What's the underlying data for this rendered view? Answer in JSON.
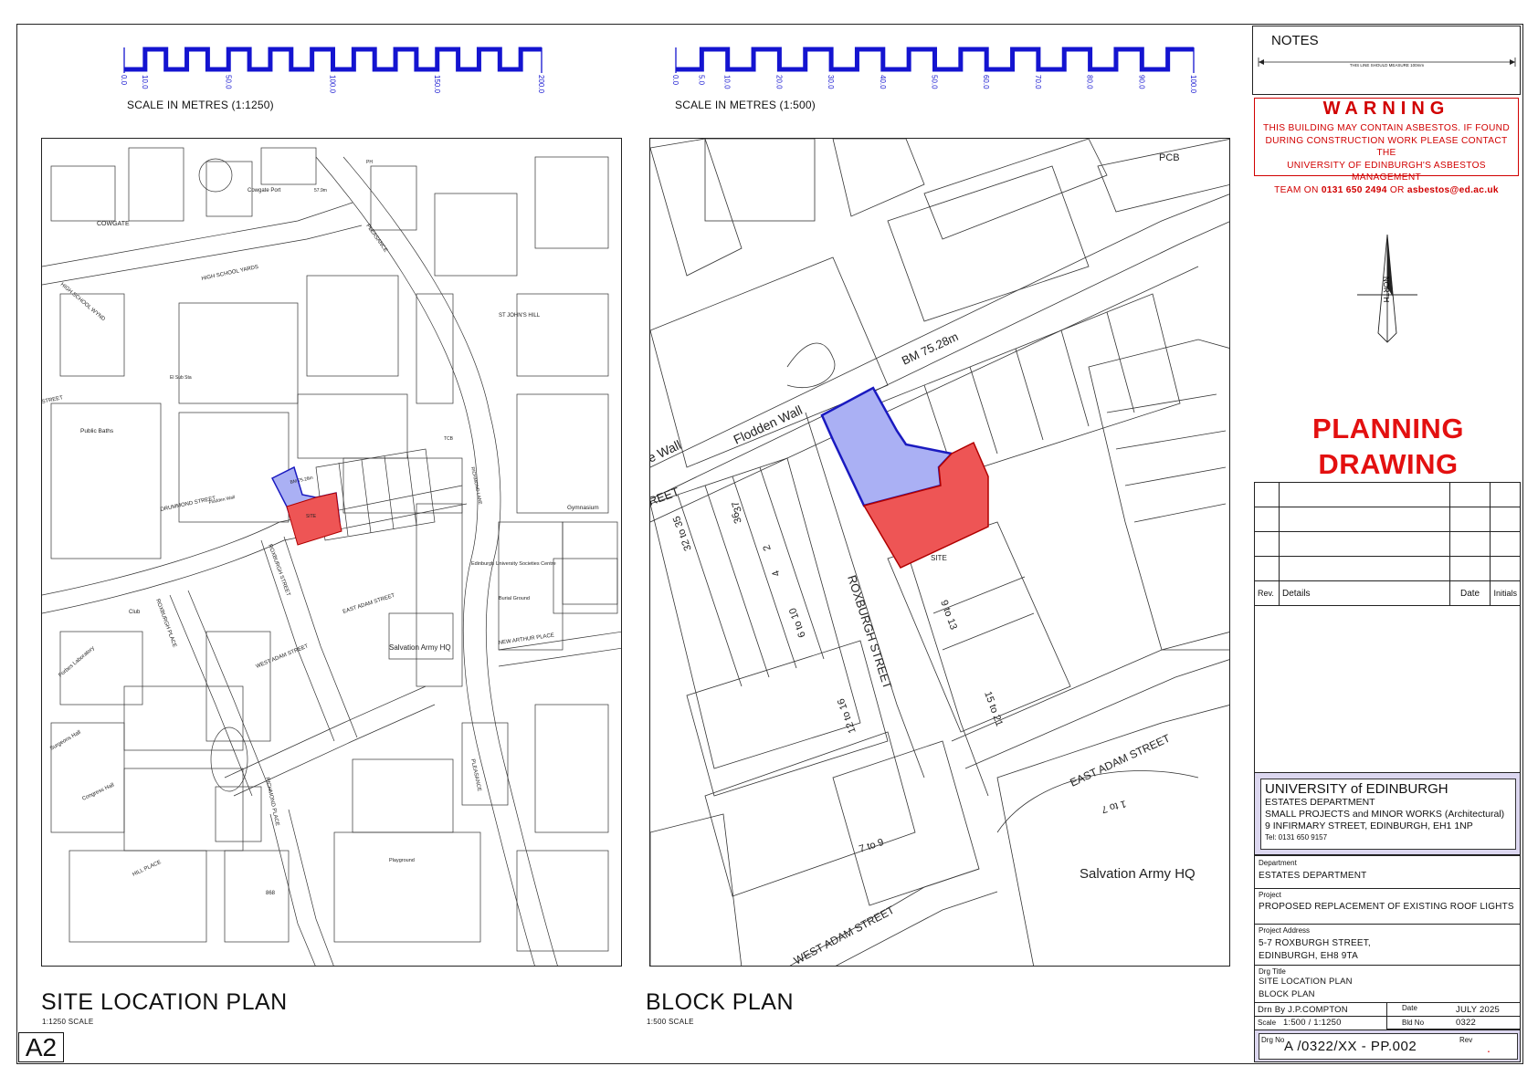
{
  "sheet": {
    "size_label": "A2"
  },
  "scale_bars": {
    "left": {
      "ticks": [
        "0.0",
        "10.0",
        "50.0",
        "100.0",
        "150.0",
        "200.0"
      ],
      "label": "SCALE IN METRES (1:1250)"
    },
    "right": {
      "ticks": [
        "0.0",
        "5.0",
        "10.0",
        "20.0",
        "30.0",
        "40.0",
        "50.0",
        "60.0",
        "70.0",
        "80.0",
        "90.0",
        "100.0"
      ],
      "label": "SCALE IN METRES (1:500)"
    }
  },
  "site_location_plan": {
    "title": "SITE LOCATION PLAN",
    "subtitle": "1:1250 SCALE",
    "labels": {
      "cowgate": "COWGATE",
      "cowgate_port": "Cowgate Port",
      "high_school_yards": "HIGH SCHOOL YARDS",
      "high_school_wynd": "HIGH SCHOOL WYND",
      "pleasance_top": "PLEASANCE",
      "pleasance_bottom": "PLEASANCE",
      "st_johns_hill": "ST JOHN'S HILL",
      "public_baths": "Public Baths",
      "drummond_street": "DRUMMOND STREET",
      "street_left": "STREET",
      "roxburgh_street": "ROXBURGH STREET",
      "roxburgh_place": "ROXBURGH PLACE",
      "east_adam_street": "EAST ADAM STREET",
      "west_adam_street": "WEST ADAM STREET",
      "new_arthur_place": "NEW ARTHUR PLACE",
      "salvation_army": "Salvation Army HQ",
      "societies_centre": "Edinburgh University Societies Centre",
      "burial_ground": "Burial Ground",
      "gymnasium": "Gymnasium",
      "club": "Club",
      "forbes_lab": "Forbes Laboratory",
      "surgeons_hall": "Surgeons Hall",
      "congress_hall": "Congress Hall",
      "playground": "Playground",
      "hill_place": "HILL PLACE",
      "richmond_place": "RICHMOND PLACE",
      "site": "SITE",
      "bm": "BM 75.28m",
      "el_sub": "El Sub Sta",
      "flodden_wall": "Flodden Wall",
      "richmond_lane": "RICHMOND LANE",
      "spot_height": "57.9m",
      "tcb": "TCB",
      "ph": "PH",
      "house_no": "868"
    }
  },
  "block_plan": {
    "title": "BLOCK PLAN",
    "subtitle": "1:500 SCALE",
    "labels": {
      "pcb": "PCB",
      "bm": "BM 75.28m",
      "flodden_wall": "Flodden Wall",
      "wall_fragment": "e Wall",
      "street_fragment": "REET",
      "roxburgh_street": "ROXBURGH STREET",
      "east_adam_street": "EAST ADAM STREET",
      "west_adam_street": "WEST ADAM STREET",
      "salvation_army": "Salvation Army HQ",
      "site": "SITE",
      "no_32_35": "32 to 35",
      "no_36": "36",
      "no_37": "37",
      "no_2": "2",
      "no_4": "4",
      "no_6_10": "6 to 10",
      "no_12_16": "12 to 16",
      "no_9_13": "9 to 13",
      "no_15_21": "15 to 21",
      "no_7_9": "7 to 9",
      "no_1_7": "1 to 7"
    }
  },
  "title_block": {
    "notes_title": "NOTES",
    "measure_line": "THIS LINE SHOULD MEASURE 100mm",
    "warning_title": "WARNING",
    "warning_lines": [
      "THIS BUILDING MAY CONTAIN ASBESTOS. IF FOUND",
      "DURING CONSTRUCTION WORK PLEASE CONTACT THE",
      "UNIVERSITY OF EDINBURGH'S ASBESTOS MANAGEMENT"
    ],
    "warning_last_prefix": "TEAM ON ",
    "warning_phone": "0131 650 2494",
    "warning_or": " OR ",
    "warning_email": "asbestos@ed.ac.uk",
    "north_label": "NORTH",
    "planning_line1": "PLANNING",
    "planning_line2": "DRAWING",
    "rev_headers": {
      "rev": "Rev.",
      "details": "Details",
      "date": "Date",
      "initials": "Initials"
    },
    "org": {
      "name": "UNIVERSITY of EDINBURGH",
      "dept": "ESTATES DEPARTMENT",
      "unit": "SMALL PROJECTS and MINOR WORKS (Architectural)",
      "address": "9 INFIRMARY STREET, EDINBURGH, EH1 1NP",
      "tel": "Tel: 0131 650 9157"
    },
    "department_caption": "Department",
    "department": "ESTATES DEPARTMENT",
    "project_caption": "Project",
    "project": "PROPOSED REPLACEMENT OF EXISTING ROOF LIGHTS",
    "address_caption": "Project Address",
    "address_line1": "5-7 ROXBURGH STREET,",
    "address_line2": "EDINBURGH, EH8 9TA",
    "drg_title_caption": "Drg Title",
    "drg_title_line1": "SITE LOCATION PLAN",
    "drg_title_line2": "BLOCK PLAN",
    "drn_by": "Drn By J.P.COMPTON",
    "date_caption": "Date",
    "date": "JULY 2025",
    "scale_caption": "Scale",
    "scale": "1:500 / 1:1250",
    "bld_no_caption": "Bld No",
    "bld_no": "0322",
    "drg_no_caption": "Drg No",
    "drg_no": "A /0322/XX - PP.002",
    "rev_caption": "Rev",
    "rev_value": "."
  },
  "colors": {
    "site_red": "#ee5555",
    "site_blue": "#aab0f4",
    "site_blue_outline": "#1a1ac0",
    "scale_blue": "#1414d0",
    "warning_red": "#d10000",
    "planning_red": "#e31010",
    "org_panel": "#dcd7f0"
  }
}
